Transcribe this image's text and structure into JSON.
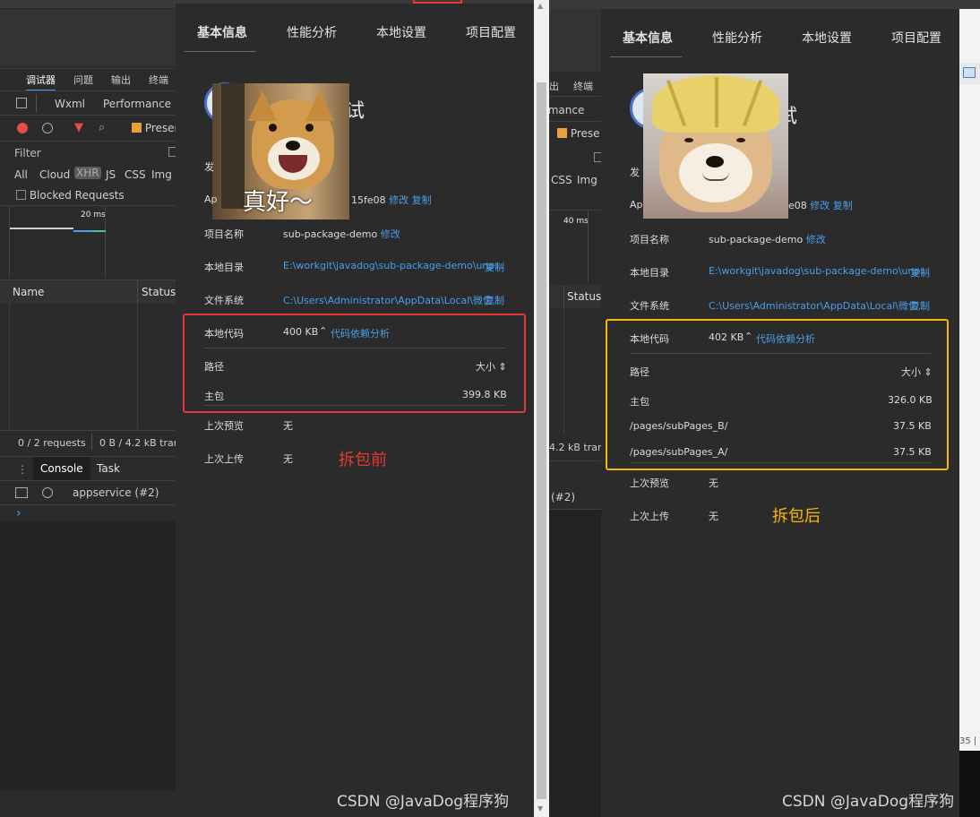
{
  "devtools": {
    "main_tabs": [
      "调试器",
      "问题",
      "输出",
      "终端"
    ],
    "sub_tabs": [
      "Wxml",
      "Performance"
    ],
    "preserve_label": "Preser",
    "filter_placeholder": "Filter",
    "types": [
      "All",
      "Cloud",
      "XHR",
      "JS",
      "CSS",
      "Img"
    ],
    "blocked_requests": "Blocked Requests",
    "timeline_label": "20 ms",
    "columns": [
      "Name",
      "Status"
    ],
    "requests_summary": "0 / 2 requests",
    "transfer_summary": "0 B / 4.2 kB tran",
    "console_tabs": [
      "Console",
      "Task"
    ],
    "context": "appservice (#2)",
    "prompt": "›"
  },
  "middle_devtools": {
    "tab": "出",
    "tab2": "终端",
    "sub_tab": "rmance",
    "preserve_label": "Prese",
    "types": [
      "CSS",
      "Img"
    ],
    "timeline_label": "40 ms",
    "status_col": "Status",
    "transfer_summary": "4.2 kB tran",
    "context": "(#2)"
  },
  "panel_before": {
    "tabs": [
      "基本信息",
      "性能分析",
      "本地设置",
      "项目配置"
    ],
    "title_partial": "试",
    "release_label_partial": "发",
    "appid_label_partial": "Ap",
    "appid_partial": "15fe08",
    "edit": "修改",
    "copy": "复制",
    "project_name_label": "项目名称",
    "project_name": "sub-package-demo",
    "local_dir_label": "本地目录",
    "local_dir": "E:\\workgit\\javadog\\sub-package-demo\\unp...",
    "fs_label": "文件系统",
    "fs_path": "C:\\Users\\Administrator\\AppData\\Local\\微信...",
    "code_label": "本地代码",
    "code_size": "400 KB",
    "dep_analysis": "代码依赖分析",
    "path_header": "路径",
    "size_header": "大小 ⇕",
    "packages": [
      {
        "name": "主包",
        "size": "399.8 KB"
      }
    ],
    "last_preview_label": "上次预览",
    "last_preview": "无",
    "last_upload_label": "上次上传",
    "last_upload": "无",
    "caption": "拆包前",
    "caption_color": "#e53935",
    "highlight_color": "#e53935",
    "meme_text": "真好～",
    "watermark": "CSDN @JavaDog程序狗"
  },
  "panel_after": {
    "tabs": [
      "基本信息",
      "性能分析",
      "本地设置",
      "项目配置"
    ],
    "title_partial": "试",
    "release_label_partial": "发",
    "appid_label_partial": "Ap",
    "appid_partial": "e08",
    "edit": "修改",
    "copy": "复制",
    "project_name_label": "项目名称",
    "project_name": "sub-package-demo",
    "local_dir_label": "本地目录",
    "local_dir": "E:\\workgit\\javadog\\sub-package-demo\\unp...",
    "fs_label": "文件系统",
    "fs_path": "C:\\Users\\Administrator\\AppData\\Local\\微信...",
    "code_label": "本地代码",
    "code_size": "402 KB",
    "dep_analysis": "代码依赖分析",
    "path_header": "路径",
    "size_header": "大小 ⇕",
    "packages": [
      {
        "name": "主包",
        "size": "326.0 KB"
      },
      {
        "name": "/pages/subPages_B/",
        "size": "37.5 KB"
      },
      {
        "name": "/pages/subPages_A/",
        "size": "37.5 KB"
      }
    ],
    "last_preview_label": "上次预览",
    "last_preview": "无",
    "last_upload_label": "上次上传",
    "last_upload": "无",
    "caption": "拆包后",
    "caption_color": "#f5b70a",
    "highlight_color": "#f5b70a",
    "watermark": "CSDN @JavaDog程序狗"
  },
  "right_edge": {
    "fragment": "35 | 4"
  }
}
